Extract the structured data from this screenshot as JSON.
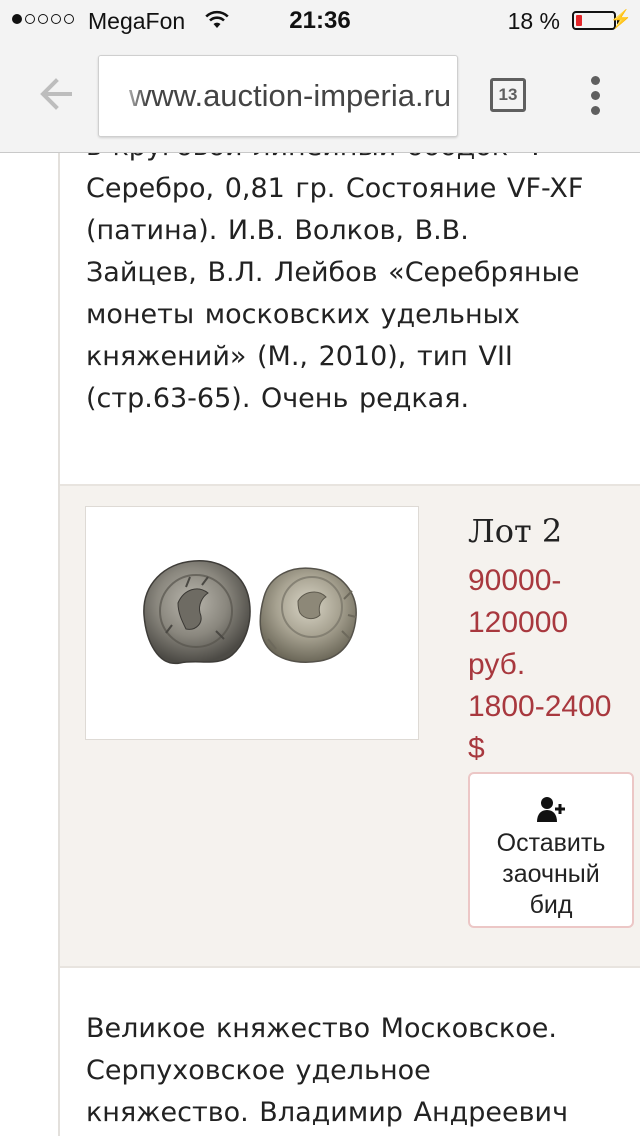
{
  "status_bar": {
    "carrier": "MegaFon",
    "time": "21:36",
    "battery_percent": "18 %",
    "battery_level": 0.18,
    "signal_bars_filled": 1,
    "signal_bars_total": 5
  },
  "browser": {
    "url": "www.auction-imperia.ru",
    "tab_count": "13",
    "icons": [
      "back-arrow-icon",
      "tabs-icon",
      "overflow-menu-icon"
    ]
  },
  "page": {
    "prev_description_lines": [
      "в круговой линейный ободок \".",
      "Серебро, 0,81 гр. Состояние VF-XF",
      "(патина). И.В. Волков, В.В.",
      "Зайцев, В.Л. Лейбов «Серебряные",
      "монеты московских удельных",
      "княжений» (М., 2010), тип VII",
      "(стр.63-65). Очень редкая."
    ],
    "lot": {
      "title": "Лот 2",
      "price_lines": [
        "90000-",
        "120000",
        "руб.",
        "1800-2400",
        "$"
      ],
      "bid_button_lines": [
        "Оставить",
        "заочный",
        "бид"
      ],
      "bid_icon": "add-user-icon",
      "image": "coin-photo"
    },
    "next_description_lines": [
      "Великое княжество Московское.",
      "Серпуховское удельное",
      "княжество. Владимир Андреевич"
    ]
  },
  "colors": {
    "price": "#a8383e",
    "lot_background": "#f5f2ee",
    "bid_border": "#ecc7c6",
    "battery_low": "#e3262a"
  }
}
